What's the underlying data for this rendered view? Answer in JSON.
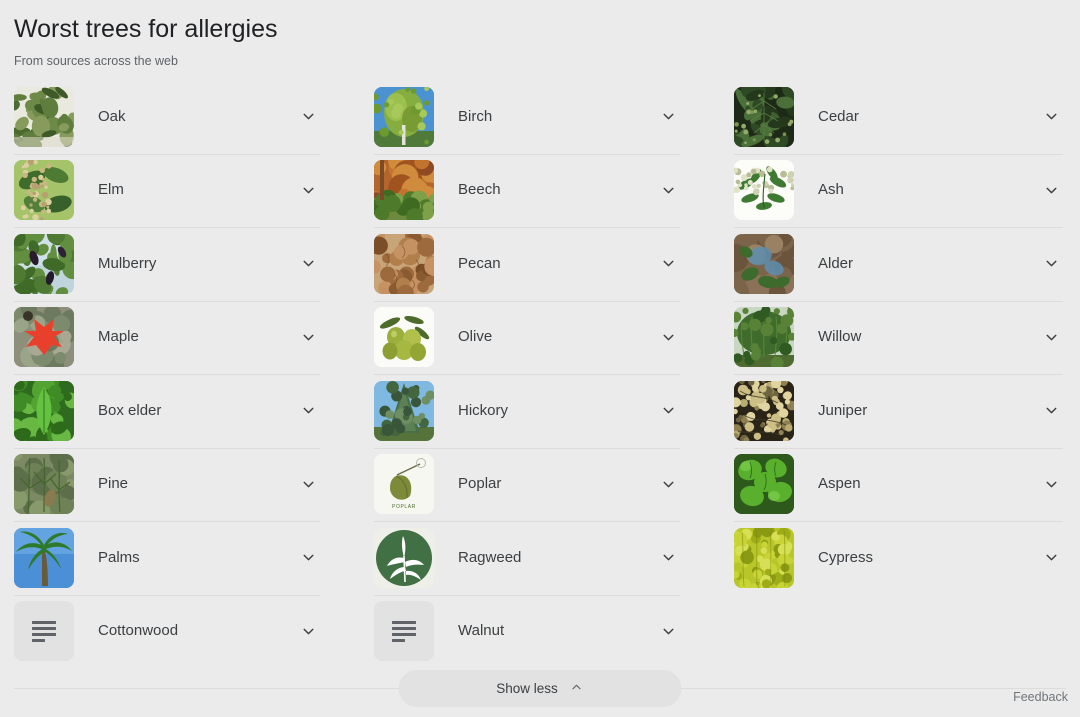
{
  "header": {
    "title": "Worst trees for allergies",
    "subtitle": "From sources across the web"
  },
  "colors": {
    "background": "#ebebeb",
    "divider": "#dcdcdc",
    "title_text": "#202124",
    "body_text": "#3c4043",
    "muted_text": "#5f6368",
    "pill_background": "#e2e2e2"
  },
  "columns": [
    {
      "items": [
        {
          "label": "Oak",
          "thumb": "oak-thumbnail",
          "expand_icon": "chevron-down-icon"
        },
        {
          "label": "Elm",
          "thumb": "elm-thumbnail",
          "expand_icon": "chevron-down-icon"
        },
        {
          "label": "Mulberry",
          "thumb": "mulberry-thumbnail",
          "expand_icon": "chevron-down-icon"
        },
        {
          "label": "Maple",
          "thumb": "maple-thumbnail",
          "expand_icon": "chevron-down-icon"
        },
        {
          "label": "Box elder",
          "thumb": "box-elder-thumbnail",
          "expand_icon": "chevron-down-icon"
        },
        {
          "label": "Pine",
          "thumb": "pine-thumbnail",
          "expand_icon": "chevron-down-icon"
        },
        {
          "label": "Palms",
          "thumb": "palms-thumbnail",
          "expand_icon": "chevron-down-icon"
        },
        {
          "label": "Cottonwood",
          "thumb": "placeholder-thumbnail",
          "expand_icon": "chevron-down-icon"
        }
      ]
    },
    {
      "items": [
        {
          "label": "Birch",
          "thumb": "birch-thumbnail",
          "expand_icon": "chevron-down-icon"
        },
        {
          "label": "Beech",
          "thumb": "beech-thumbnail",
          "expand_icon": "chevron-down-icon"
        },
        {
          "label": "Pecan",
          "thumb": "pecan-thumbnail",
          "expand_icon": "chevron-down-icon"
        },
        {
          "label": "Olive",
          "thumb": "olive-thumbnail",
          "expand_icon": "chevron-down-icon"
        },
        {
          "label": "Hickory",
          "thumb": "hickory-thumbnail",
          "expand_icon": "chevron-down-icon"
        },
        {
          "label": "Poplar",
          "thumb": "poplar-thumbnail",
          "expand_icon": "chevron-down-icon"
        },
        {
          "label": "Ragweed",
          "thumb": "ragweed-thumbnail",
          "expand_icon": "chevron-down-icon"
        },
        {
          "label": "Walnut",
          "thumb": "placeholder-thumbnail",
          "expand_icon": "chevron-down-icon"
        }
      ]
    },
    {
      "items": [
        {
          "label": "Cedar",
          "thumb": "cedar-thumbnail",
          "expand_icon": "chevron-down-icon"
        },
        {
          "label": "Ash",
          "thumb": "ash-thumbnail",
          "expand_icon": "chevron-down-icon"
        },
        {
          "label": "Alder",
          "thumb": "alder-thumbnail",
          "expand_icon": "chevron-down-icon"
        },
        {
          "label": "Willow",
          "thumb": "willow-thumbnail",
          "expand_icon": "chevron-down-icon"
        },
        {
          "label": "Juniper",
          "thumb": "juniper-thumbnail",
          "expand_icon": "chevron-down-icon"
        },
        {
          "label": "Aspen",
          "thumb": "aspen-thumbnail",
          "expand_icon": "chevron-down-icon"
        },
        {
          "label": "Cypress",
          "thumb": "cypress-thumbnail",
          "expand_icon": "chevron-down-icon"
        }
      ]
    }
  ],
  "poplar_thumb_caption": "POPLAR",
  "footer": {
    "show_less_label": "Show less",
    "show_less_icon": "chevron-up-icon",
    "feedback_label": "Feedback"
  }
}
